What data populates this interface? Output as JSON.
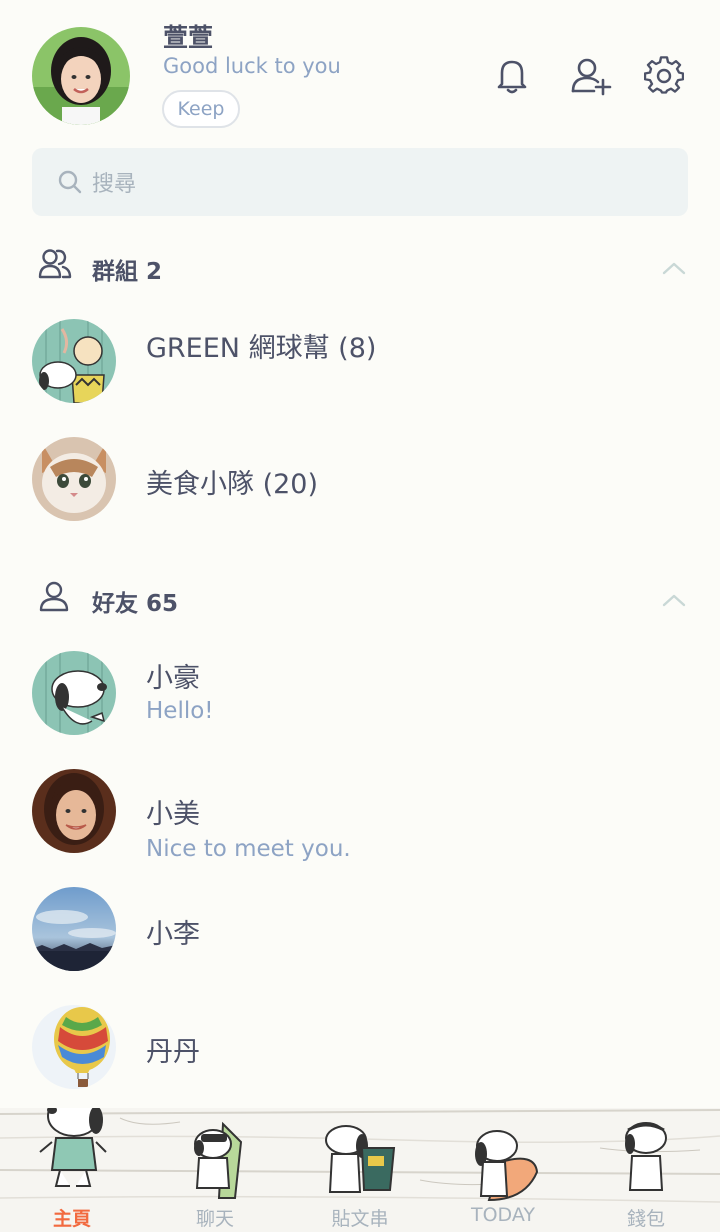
{
  "profile": {
    "name": "萱萱",
    "status": "Good luck to you",
    "keep_label": "Keep"
  },
  "search": {
    "placeholder": "搜尋"
  },
  "groups": {
    "header": "群組 2",
    "items": [
      {
        "name": "GREEN 網球幫 (8)"
      },
      {
        "name": "美食小隊 (20)"
      }
    ]
  },
  "friends": {
    "header": "好友 65",
    "items": [
      {
        "name": "小豪",
        "message": "Hello!"
      },
      {
        "name": "小美",
        "message": "Nice to meet you."
      },
      {
        "name": "小李",
        "message": ""
      },
      {
        "name": "丹丹",
        "message": ""
      }
    ]
  },
  "nav": {
    "items": [
      {
        "label": "主頁",
        "active": true
      },
      {
        "label": "聊天",
        "active": false
      },
      {
        "label": "貼文串",
        "active": false
      },
      {
        "label": "TODAY",
        "active": false
      },
      {
        "label": "錢包",
        "active": false
      }
    ]
  },
  "colors": {
    "accent_active": "#f26a3f",
    "status_text": "#8da3c4",
    "primary_text": "#4d5268",
    "search_bg": "#eef3f3"
  },
  "icons": [
    "bell-icon",
    "add-friend-icon",
    "settings-gear-icon",
    "search-icon",
    "group-icon",
    "friend-icon",
    "chevron-up-icon"
  ]
}
